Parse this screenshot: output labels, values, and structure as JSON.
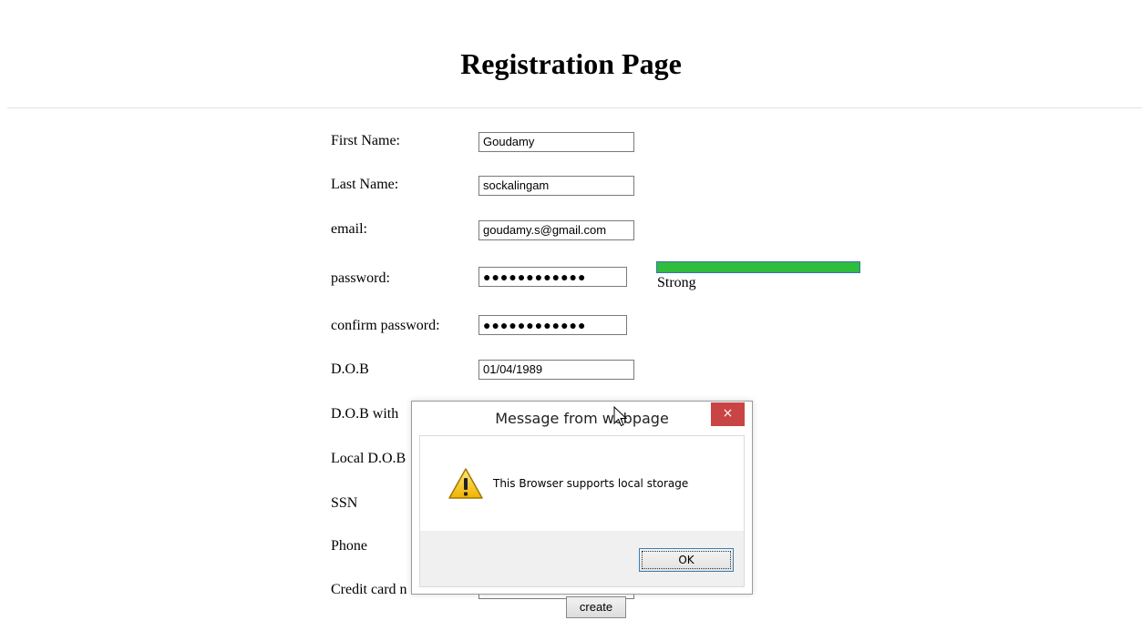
{
  "page": {
    "title": "Registration Page"
  },
  "form": {
    "first_name": {
      "label": "First Name:",
      "value": "Goudamy"
    },
    "last_name": {
      "label": "Last Name:",
      "value": "sockalingam"
    },
    "email": {
      "label": "email:",
      "value": "goudamy.s@gmail.com"
    },
    "password": {
      "label": "password:",
      "masked_value": "●●●●●●●●●●●●"
    },
    "confirm_password": {
      "label": "confirm password:",
      "masked_value": "●●●●●●●●●●●●"
    },
    "dob": {
      "label": "D.O.B",
      "value": "01/04/1989"
    },
    "dob_with": {
      "label": "D.O.B with"
    },
    "local_dob": {
      "label": "Local D.O.B"
    },
    "ssn": {
      "label": "SSN"
    },
    "phone": {
      "label": "Phone"
    },
    "credit_card": {
      "label": "Credit card n"
    },
    "create_label": "create"
  },
  "password_strength": {
    "label": "Strong",
    "level": 1.0,
    "color": "#2ebd3c"
  },
  "dialog": {
    "title": "Message from webpage",
    "message": "This Browser supports local storage",
    "ok_label": "OK",
    "close_glyph": "×",
    "icon": "warning-icon",
    "close_color": "#c94444"
  }
}
